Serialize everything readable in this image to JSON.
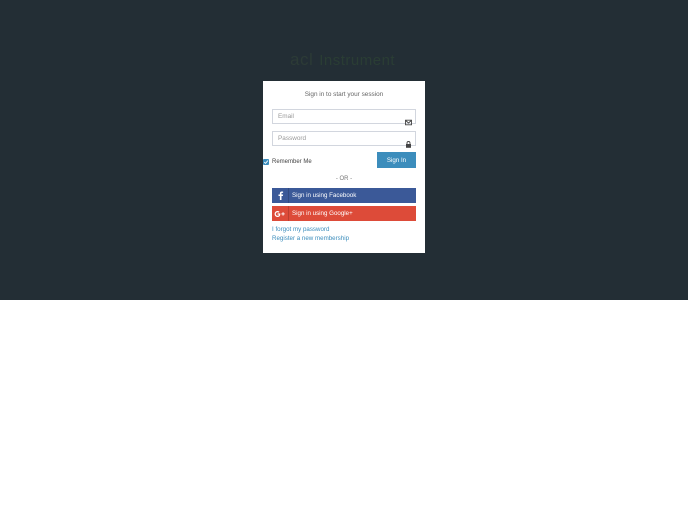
{
  "logo": {
    "part_a": "acl",
    "part_b": "Instrument"
  },
  "login": {
    "message": "Sign in to start your session",
    "email_placeholder": "Email",
    "password_placeholder": "Password",
    "remember_label": "Remember Me",
    "remember_checked": true,
    "signin_label": "Sign In",
    "or_text": "- OR -",
    "facebook_label": "Sign in using Facebook",
    "google_label": "Sign in using Google+",
    "forgot_link": "I forgot my password",
    "register_link": "Register a new membership"
  },
  "colors": {
    "background_dark": "#232e35",
    "primary": "#3c8dbc",
    "facebook": "#3b5998",
    "google": "#dd4b39"
  },
  "icons": {
    "email": "envelope-icon",
    "password": "lock-icon",
    "facebook": "facebook-icon",
    "google": "google-plus-icon",
    "checkbox": "checkmark-icon"
  }
}
